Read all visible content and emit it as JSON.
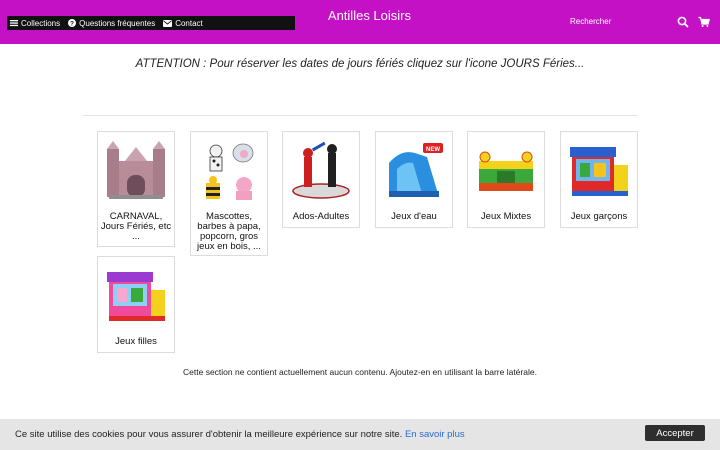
{
  "header": {
    "background": "#c511c5",
    "nav": [
      {
        "icon": "menu-icon",
        "label": "Collections"
      },
      {
        "icon": "question-circle-icon",
        "label": "Questions fréquentes"
      },
      {
        "icon": "envelope-icon",
        "label": "Contact"
      }
    ],
    "brand_glyph": "",
    "brand_title": "Antilles Loisirs",
    "brand_sub_glyph": "",
    "search_placeholder": "Rechercher",
    "search_icon": "search-icon",
    "cart_icon": "cart-icon"
  },
  "notice": "ATTENTION : Pour réserver les dates de jours fériés cliquez sur l'icone JOURS Féries...",
  "collections": [
    {
      "label": "CARNAVAL, Jours Fériés, etc ..."
    },
    {
      "label": "Mascottes, barbes à papa, popcorn, gros jeux en bois, ..."
    },
    {
      "label": "Ados-Adultes"
    },
    {
      "label": "Jeux d'eau"
    },
    {
      "label": "Jeux Mixtes"
    },
    {
      "label": "Jeux garçons"
    },
    {
      "label": "Jeux filles"
    }
  ],
  "empty_message": "Cette section ne contient actuellement aucun contenu. Ajoutez-en en utilisant la barre latérale.",
  "cookie": {
    "text": "Ce site utilise des cookies pour vous assurer d'obtenir la meilleure expérience sur notre site.",
    "link": "En savoir plus",
    "accept": "Accepter"
  }
}
